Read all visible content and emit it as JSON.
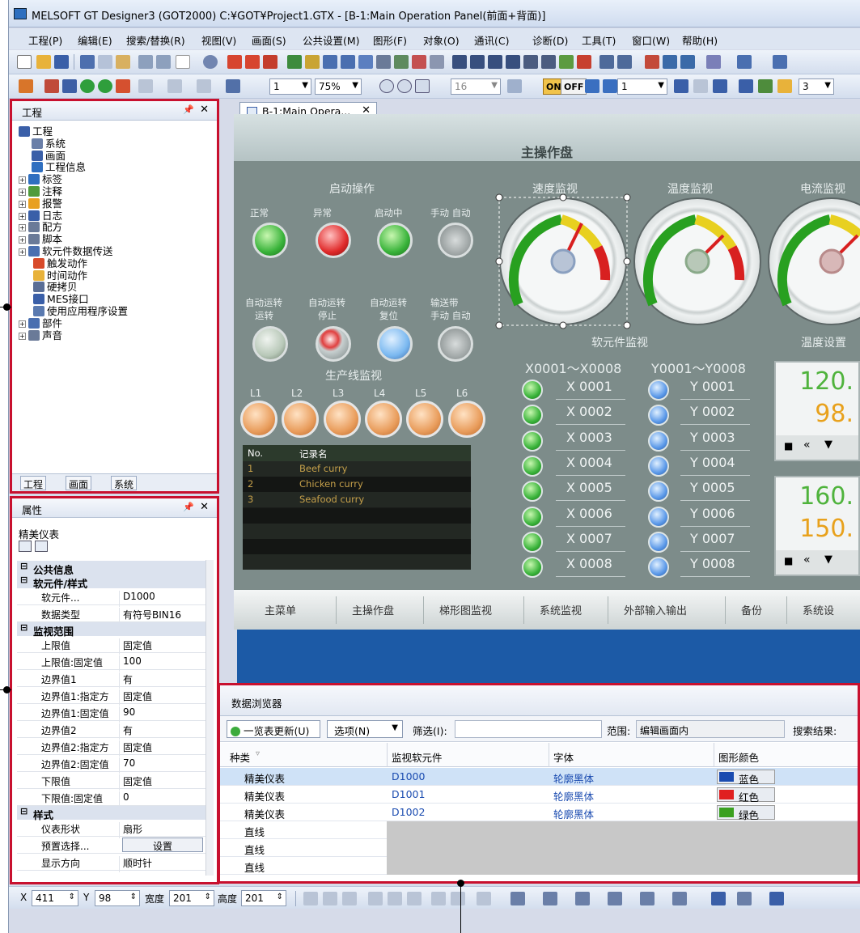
{
  "window": {
    "title": "MELSOFT GT Designer3 (GOT2000) C:¥GOT¥Project1.GTX - [B-1:Main Operation Panel(前面+背面)]"
  },
  "menu": [
    "工程(P)",
    "编辑(E)",
    "搜索/替换(R)",
    "视图(V)",
    "画面(S)",
    "公共设置(M)",
    "图形(F)",
    "对象(O)",
    "通讯(C)",
    "诊断(D)",
    "工具(T)",
    "窗口(W)",
    "帮助(H)"
  ],
  "toolbar": {
    "screen_no": "1",
    "zoom": "75%",
    "grid": "16",
    "on": "ON",
    "off": "OFF",
    "layer": "1",
    "right_combo": "3"
  },
  "project_panel": {
    "title": "工程",
    "tree": [
      "工程",
      "系统",
      "画面",
      "工程信息",
      "标签",
      "注释",
      "报警",
      "日志",
      "配方",
      "脚本",
      "软元件数据传送",
      "触发动作",
      "时间动作",
      "硬拷贝",
      "MES接口",
      "使用应用程序设置",
      "部件",
      "声音"
    ],
    "tabs": [
      "工程",
      "画面",
      "系统"
    ]
  },
  "property_panel": {
    "title": "属性",
    "object": "精美仪表",
    "rows": [
      {
        "type": "section",
        "k": "公共信息"
      },
      {
        "type": "section",
        "k": "软元件/样式"
      },
      {
        "type": "row",
        "k": "软元件...",
        "v": "D1000"
      },
      {
        "type": "row",
        "k": "数据类型",
        "v": "有符号BIN16"
      },
      {
        "type": "section",
        "k": "监视范围"
      },
      {
        "type": "row",
        "k": "上限值",
        "v": "固定值"
      },
      {
        "type": "row",
        "k": "上限值:固定值",
        "v": "100"
      },
      {
        "type": "row",
        "k": "边界值1",
        "v": "有"
      },
      {
        "type": "row",
        "k": "边界值1:指定方",
        "v": "固定值"
      },
      {
        "type": "row",
        "k": "边界值1:固定值",
        "v": "90"
      },
      {
        "type": "row",
        "k": "边界值2",
        "v": "有"
      },
      {
        "type": "row",
        "k": "边界值2:指定方",
        "v": "固定值"
      },
      {
        "type": "row",
        "k": "边界值2:固定值",
        "v": "70"
      },
      {
        "type": "row",
        "k": "下限值",
        "v": "固定值"
      },
      {
        "type": "row",
        "k": "下限值:固定值",
        "v": "0"
      },
      {
        "type": "section",
        "k": "样式"
      },
      {
        "type": "row",
        "k": "仪表形状",
        "v": "扇形"
      },
      {
        "type": "row",
        "k": "预置选择...",
        "v": "设置"
      },
      {
        "type": "row",
        "k": "显示方向",
        "v": "顺时针"
      }
    ]
  },
  "doc_tab": "B-1:Main Opera...",
  "screen": {
    "title": "主操作盘",
    "start_op": "启动操作",
    "lamp_row1": [
      "正常",
      "异常",
      "启动中",
      "手动  自动"
    ],
    "lamp_row2a": [
      "自动运转",
      "自动运转",
      "自动运转",
      "输送带"
    ],
    "lamp_row2b": [
      "运转",
      "停止",
      "复位",
      "手动  自动"
    ],
    "gauges": [
      "速度监视",
      "温度监视",
      "电流监视"
    ],
    "device_monitor": "软元件监视",
    "temp_setting": "温度设置",
    "x_range": "X0001～X0008",
    "y_range": "Y0001～Y0008",
    "x_devs": [
      "X 0001",
      "X 0002",
      "X 0003",
      "X 0004",
      "X 0005",
      "X 0006",
      "X 0007",
      "X 0008"
    ],
    "y_devs": [
      "Y 0001",
      "Y 0002",
      "Y 0003",
      "Y 0004",
      "Y 0005",
      "Y 0006",
      "Y 0007",
      "Y 0008"
    ],
    "line_monitor": "生产线监视",
    "lines": [
      "L1",
      "L2",
      "L3",
      "L4",
      "L5",
      "L6"
    ],
    "recipe_head": [
      "No.",
      "记录名"
    ],
    "recipes": [
      [
        "1",
        "Beef curry"
      ],
      [
        "2",
        "Chicken curry"
      ],
      [
        "3",
        "Seafood curry"
      ]
    ],
    "temp1": [
      "120.",
      "98."
    ],
    "temp2": [
      "160.",
      "150."
    ],
    "nav": [
      "主菜单",
      "主操作盘",
      "梯形图监视",
      "系统监视",
      "外部输入输出",
      "备份",
      "系统设"
    ]
  },
  "data_browser": {
    "title": "数据浏览器",
    "refresh": "一览表更新(U)",
    "options": "选项(N)",
    "filter": "筛选(I):",
    "range_label": "范围:",
    "range_value": "编辑画面内",
    "search_result": "搜索结果:",
    "headers": [
      "种类",
      "监视软元件",
      "字体",
      "图形颜色"
    ],
    "rows": [
      [
        "精美仪表",
        "D1000",
        "轮廓黑体",
        "蓝色"
      ],
      [
        "精美仪表",
        "D1001",
        "轮廓黑体",
        "红色"
      ],
      [
        "精美仪表",
        "D1002",
        "轮廓黑体",
        "绿色"
      ],
      [
        "直线",
        "",
        "",
        ""
      ],
      [
        "直线",
        "",
        "",
        ""
      ],
      [
        "直线",
        "",
        "",
        ""
      ]
    ],
    "color_swatches": [
      "#1a4bb0",
      "#e02020",
      "#3aa020"
    ]
  },
  "statusbar": {
    "x_label": "X",
    "x": "411",
    "y_label": "Y",
    "y": "98",
    "w_label": "宽度",
    "w": "201",
    "h_label": "高度",
    "h": "201"
  }
}
